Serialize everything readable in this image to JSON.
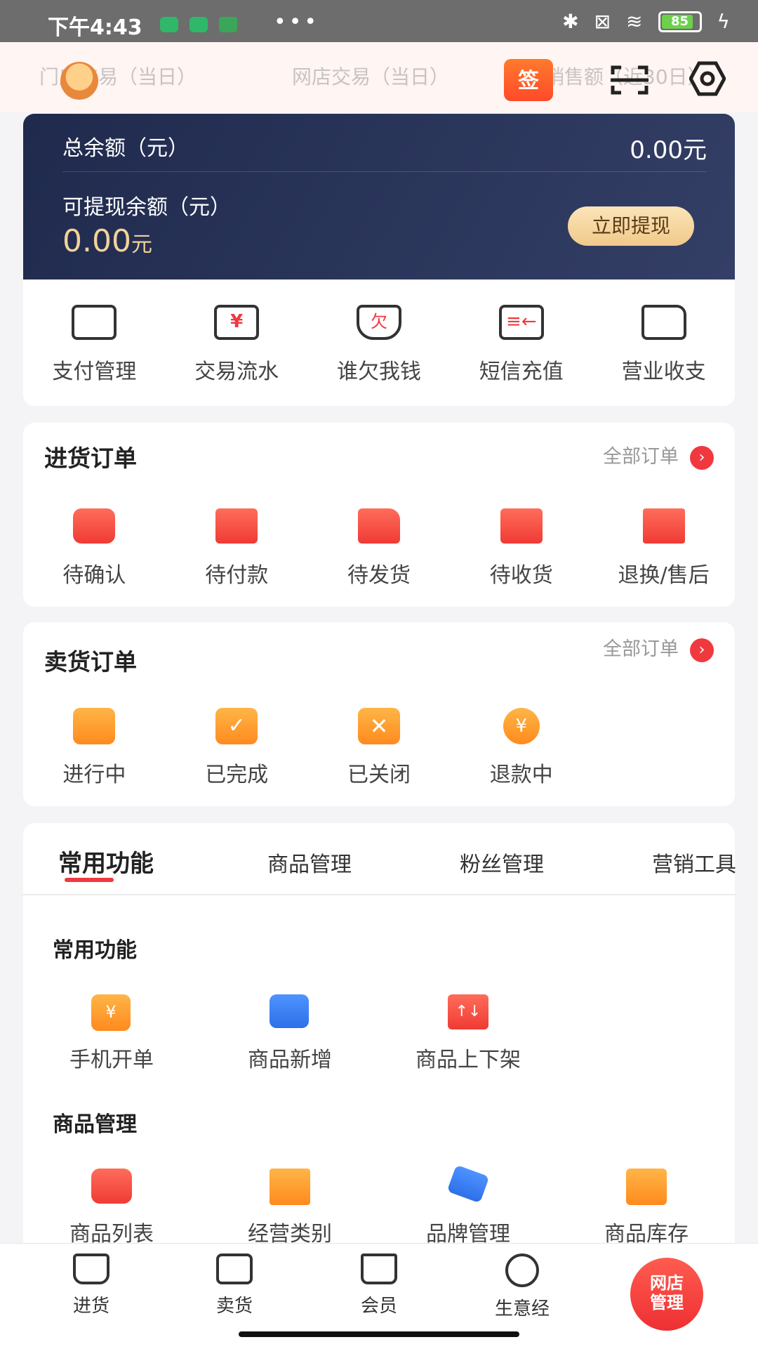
{
  "status_bar": {
    "time": "下午4:43",
    "dots": "•••",
    "battery": "85"
  },
  "header": {
    "ghost_stats": [
      "门店交易（当日）",
      "网店交易（当日）",
      "销售额（近30日）"
    ],
    "sign_label": "签"
  },
  "balance": {
    "total_label": "总余额（元）",
    "total_value": "0.00元",
    "withdrawable_label": "可提现余额（元）",
    "withdrawable_value": "0.00",
    "withdrawable_unit": "元",
    "withdraw_button": "立即提现"
  },
  "quick_actions": [
    {
      "label": "支付管理",
      "icon": "card-icon"
    },
    {
      "label": "交易流水",
      "icon": "yuan-icon"
    },
    {
      "label": "谁欠我钱",
      "icon": "debt-icon"
    },
    {
      "label": "短信充值",
      "icon": "sms-icon"
    },
    {
      "label": "营业收支",
      "icon": "wallet-icon"
    }
  ],
  "purchase_orders": {
    "title": "进货订单",
    "all_link": "全部订单",
    "items": [
      {
        "label": "待确认",
        "icon": "confirm-icon"
      },
      {
        "label": "待付款",
        "icon": "pay-icon"
      },
      {
        "label": "待发货",
        "icon": "truck-icon"
      },
      {
        "label": "待收货",
        "icon": "receive-icon"
      },
      {
        "label": "退换/售后",
        "icon": "return-icon"
      }
    ]
  },
  "sales_orders": {
    "title": "卖货订单",
    "all_link": "全部订单",
    "items": [
      {
        "label": "进行中",
        "icon": "clock-folder-icon"
      },
      {
        "label": "已完成",
        "icon": "check-icon"
      },
      {
        "label": "已关闭",
        "icon": "close-icon"
      },
      {
        "label": "退款中",
        "icon": "refund-icon"
      }
    ]
  },
  "tabs": [
    "常用功能",
    "商品管理",
    "粉丝管理",
    "营销工具"
  ],
  "groups": {
    "common": {
      "title": "常用功能",
      "items": [
        {
          "label": "手机开单",
          "icon": "phone-order-icon"
        },
        {
          "label": "商品新增",
          "icon": "add-product-icon"
        },
        {
          "label": "商品上下架",
          "icon": "shelf-icon"
        }
      ]
    },
    "products": {
      "title": "商品管理",
      "items": [
        {
          "label": "商品列表",
          "icon": "product-list-icon"
        },
        {
          "label": "经营类别",
          "icon": "category-icon"
        },
        {
          "label": "品牌管理",
          "icon": "brand-icon"
        },
        {
          "label": "商品库存",
          "icon": "inventory-icon"
        }
      ]
    }
  },
  "bottom_nav": [
    {
      "label": "进货"
    },
    {
      "label": "卖货"
    },
    {
      "label": "会员"
    },
    {
      "label": "生意经"
    }
  ],
  "shop_button": {
    "line1": "网店",
    "line2": "管理"
  },
  "colors": {
    "accent": "#f0393f",
    "card_dark": "#1f2a4d",
    "gold": "#f2d29b"
  }
}
